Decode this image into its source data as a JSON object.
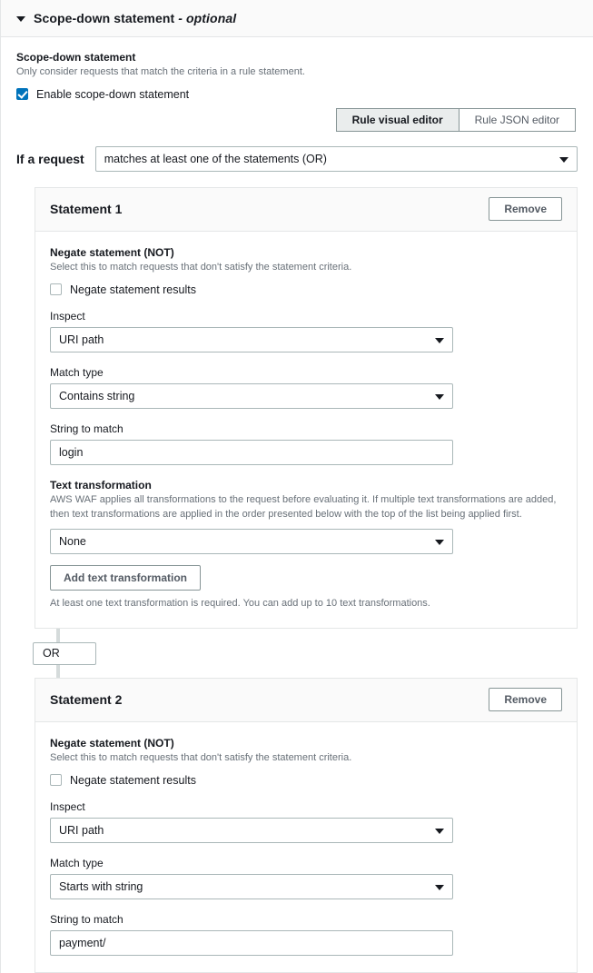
{
  "section": {
    "title": "Scope-down statement",
    "title_optional": " - optional",
    "caret_icon": "chevron-down-icon"
  },
  "scope_down": {
    "label": "Scope-down statement",
    "description": "Only consider requests that match the criteria in a rule statement.",
    "checkbox_label": "Enable scope-down statement",
    "checked": true
  },
  "editor_toggle": {
    "options": [
      {
        "label": "Rule visual editor",
        "active": true
      },
      {
        "label": "Rule JSON editor",
        "active": false
      }
    ]
  },
  "if_request": {
    "label": "If a request",
    "value": "matches at least one of the statements (OR)",
    "arrow_icon": "chevron-down-icon"
  },
  "connector": {
    "label": "OR"
  },
  "statements": [
    {
      "title": "Statement 1",
      "remove_label": "Remove",
      "negate": {
        "label": "Negate statement (NOT)",
        "description": "Select this to match requests that don't satisfy the statement criteria.",
        "checkbox_label": "Negate statement results",
        "checked": false
      },
      "inspect": {
        "label": "Inspect",
        "value": "URI path"
      },
      "match_type": {
        "label": "Match type",
        "value": "Contains string"
      },
      "string_to_match": {
        "label": "String to match",
        "value": "login",
        "placeholder": ""
      },
      "text_transformation": {
        "label": "Text transformation",
        "description": "AWS WAF applies all transformations to the request before evaluating it. If multiple text transformations are added, then text transformations are applied in the order presented below with the top of the list being applied first.",
        "value": "None",
        "add_button_label": "Add text transformation",
        "footnote": "At least one text transformation is required. You can add up to 10 text transformations."
      }
    },
    {
      "title": "Statement 2",
      "remove_label": "Remove",
      "negate": {
        "label": "Negate statement (NOT)",
        "description": "Select this to match requests that don't satisfy the statement criteria.",
        "checkbox_label": "Negate statement results",
        "checked": false
      },
      "inspect": {
        "label": "Inspect",
        "value": "URI path"
      },
      "match_type": {
        "label": "Match type",
        "value": "Starts with string"
      },
      "string_to_match": {
        "label": "String to match",
        "value": "payment/",
        "placeholder": ""
      }
    }
  ],
  "colors": {
    "accent": "#0073bb",
    "border": "#aab7b8",
    "panel_border": "#e4e6e7",
    "header_bg": "#fafafa",
    "text": "#16191f",
    "muted": "#687078",
    "connector": "#d5dbdb"
  }
}
